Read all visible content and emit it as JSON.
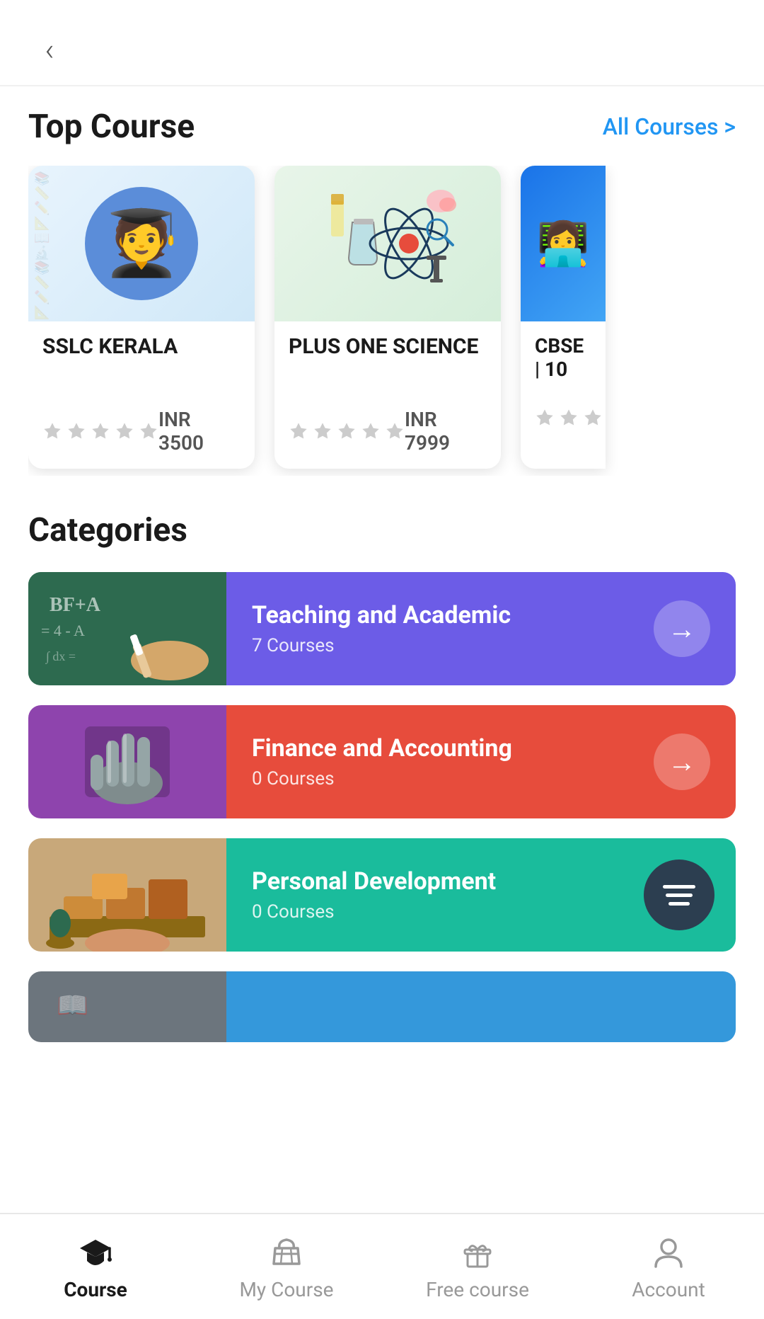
{
  "header": {
    "back_label": "‹"
  },
  "top_course": {
    "title": "Top Course",
    "all_link": "All Courses >",
    "courses": [
      {
        "id": "sslc",
        "title": "SSLC KERALA",
        "price": "INR 3500",
        "stars": [
          false,
          false,
          false,
          false,
          false
        ],
        "img_type": "sslc"
      },
      {
        "id": "plus-one-science",
        "title": "PLUS ONE SCIENCE",
        "price": "INR 7999",
        "stars": [
          false,
          false,
          false,
          false,
          false
        ],
        "img_type": "science"
      },
      {
        "id": "cbse",
        "title": "CBSE | 10",
        "price": "",
        "stars": [
          false,
          false,
          false
        ],
        "img_type": "cbse"
      }
    ]
  },
  "categories": {
    "title": "Categories",
    "items": [
      {
        "id": "teaching",
        "name": "Teaching and Academic",
        "count": "7 Courses",
        "color": "purple",
        "thumb_type": "teaching"
      },
      {
        "id": "finance",
        "name": "Finance and Accounting",
        "count": "0 Courses",
        "color": "red",
        "thumb_type": "finance"
      },
      {
        "id": "personal",
        "name": "Personal Development",
        "count": "0 Courses",
        "color": "teal",
        "thumb_type": "personal",
        "has_filter": true
      },
      {
        "id": "extra",
        "name": "",
        "count": "",
        "color": "blue",
        "thumb_type": "extra",
        "partial": true
      }
    ]
  },
  "bottom_nav": {
    "items": [
      {
        "id": "course",
        "label": "Course",
        "active": true,
        "icon": "graduation-cap"
      },
      {
        "id": "my-course",
        "label": "My Course",
        "active": false,
        "icon": "basket"
      },
      {
        "id": "free-course",
        "label": "Free course",
        "active": false,
        "icon": "gift"
      },
      {
        "id": "account",
        "label": "Account",
        "active": false,
        "icon": "person"
      }
    ]
  }
}
